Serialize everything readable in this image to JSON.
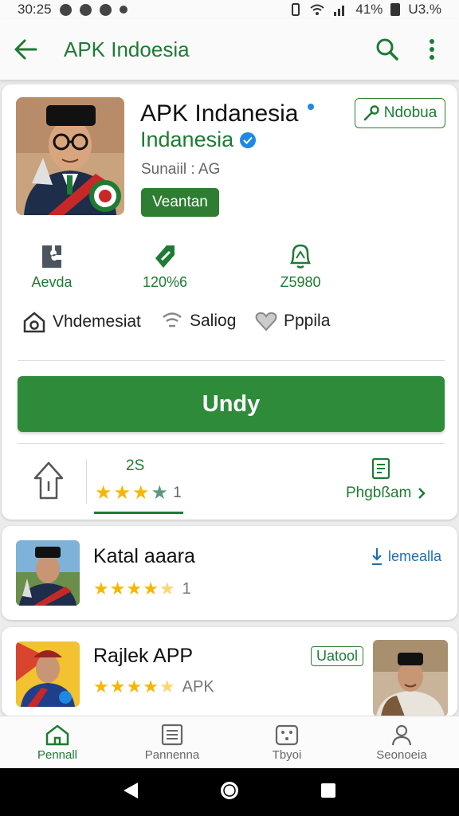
{
  "status_bar": {
    "time": "30:25",
    "battery": "41%",
    "right_text": "U3.%"
  },
  "app_bar": {
    "title": "APK Indoesia"
  },
  "app": {
    "name": "APK Indanesia",
    "developer": "Indanesia",
    "sub_label": "Sunaiil : AG",
    "chip_label": "Veantan",
    "outline_button": "Ndobua"
  },
  "stats": [
    {
      "label": "Aevda",
      "icon": "gear-puzzle-icon"
    },
    {
      "label": "120%6",
      "icon": "tag-icon"
    },
    {
      "label": "Z5980",
      "icon": "bell-icon"
    }
  ],
  "tags": [
    {
      "label": "Vhdemesiat",
      "icon": "home-icon"
    },
    {
      "label": "Saliog",
      "icon": "wifi-icon"
    },
    {
      "label": "Pppila",
      "icon": "heart-icon"
    }
  ],
  "install_button": "Undy",
  "rating": {
    "count": "2S",
    "stars": 3.5,
    "number": "1",
    "notes_link": "Phgbßam"
  },
  "list": [
    {
      "title": "Katal aaara",
      "stars": 4.5,
      "meta": "1",
      "link": "lemealla"
    },
    {
      "title": "Rajlek APP",
      "stars": 4.5,
      "meta": "APK",
      "tag": "Uatool"
    }
  ],
  "bottom_nav": [
    {
      "label": "Pennall",
      "icon": "home-icon",
      "active": true
    },
    {
      "label": "Pannenna",
      "icon": "list-icon",
      "active": false
    },
    {
      "label": "Tbyoi",
      "icon": "dice-icon",
      "active": false
    },
    {
      "label": "Seonoeia",
      "icon": "person-icon",
      "active": false
    }
  ],
  "colors": {
    "accent": "#2e8b3a",
    "brand_text": "#1e7b34",
    "link_blue": "#1e6fae",
    "star": "#f5b700"
  }
}
